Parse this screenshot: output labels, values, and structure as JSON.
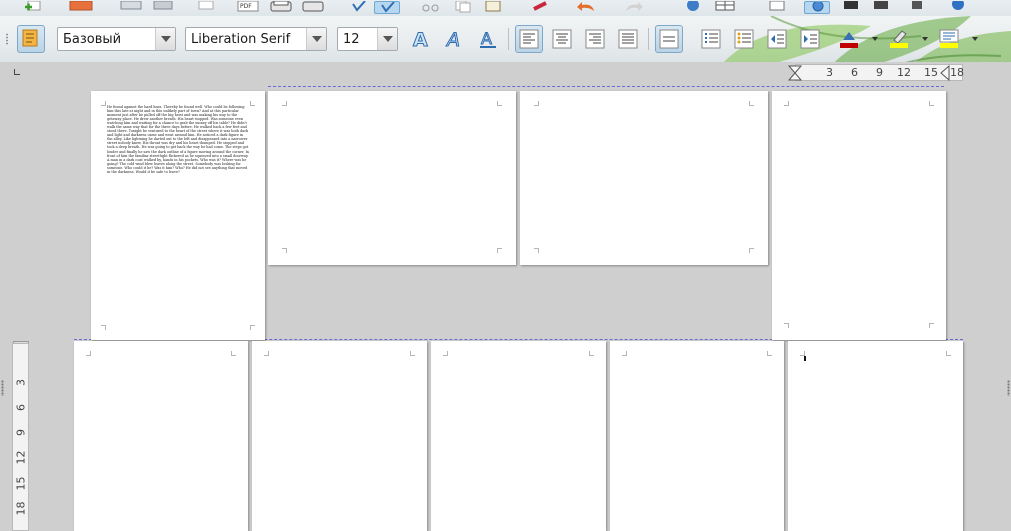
{
  "toolbar": {
    "paragraph_style": "Базовый",
    "font_name": "Liberation Serif",
    "font_size": "12",
    "icons": [
      "new-icon",
      "cut-icon",
      "copy-icon",
      "paste-icon",
      "export-pdf-icon",
      "print-icon",
      "spellcheck-icon",
      "autospell-icon",
      "undo-icon",
      "redo-icon",
      "navigator-icon",
      "styles-icon",
      "bold-outline-icon",
      "italic-outline-icon",
      "underline-outline-icon",
      "align-left-icon",
      "align-center-icon",
      "align-right-icon",
      "justify-icon",
      "line-spacing-icon",
      "numbering-icon",
      "bullets-icon",
      "decrease-indent-icon",
      "increase-indent-icon",
      "font-color-icon",
      "highlight-icon",
      "background-color-icon"
    ],
    "colors": {
      "font_color": "#c00000",
      "highlight": "#ffff00",
      "background": "#ffff00"
    }
  },
  "ruler": {
    "h_ticks": [
      "3",
      "6",
      "9",
      "12",
      "15",
      "18"
    ],
    "v_ticks": [
      "3",
      "6",
      "9",
      "12",
      "15",
      "18"
    ]
  },
  "document": {
    "page1_text": "He found against the hard lines. Thereby he found well. Who could be following him this late at night and in this unlikely part of town? And at this particular moment just after he pulled off the big heist and was making his way to the getaway place. He drew another breath. His heart stopped. Was someone even watching him and waiting for a chance to grab the money off his table? He didn't walk the same way that for the three days before. He walked back a few feet and stood there. Tonight he ventured to the heart of the street where it was both dark and light and darkness came and went around him. He noticed a dark figure in the alley. Like lightning he darted out to the left and disappeared into a narrower street nobody knew. His throat was dry and his heart thumped. He stopped and took a deep breath. He was going to get back the way he had come. The steps got louder and finally he saw the dark outline of a figure moving around the corner. In front of him the familiar streetlight flickered as he squeezed into a small doorway. A man in a dark coat walked by, hands in his pockets. Who was it? Where was he going? The cold wind blew leaves along the street. Somebody was looking for someone. Who could it be? Was it him? Who? He did not see anything that moved in the darkness. Would it be safe to leave?"
  }
}
